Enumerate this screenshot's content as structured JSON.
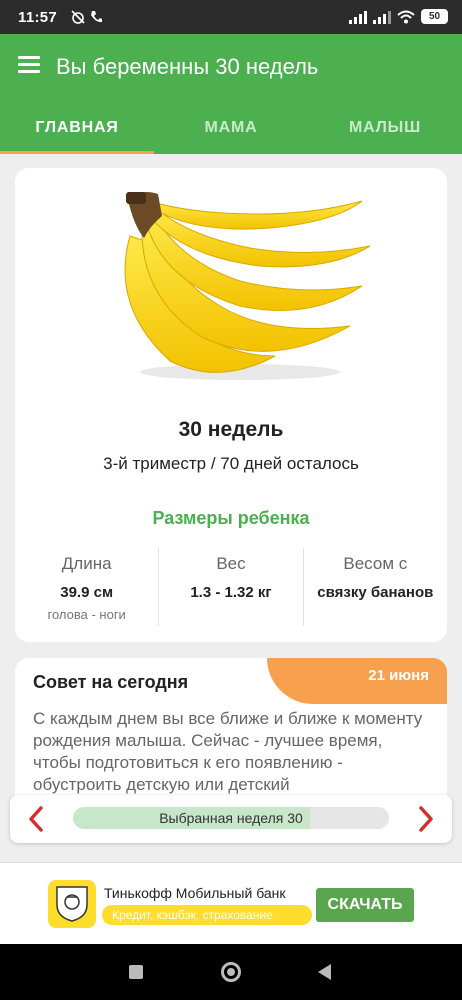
{
  "status_bar": {
    "time": "11:57",
    "battery": "50"
  },
  "app_bar": {
    "title": "Вы беременны 30 недель",
    "tabs": [
      {
        "label": "ГЛАВНАЯ",
        "selected": true
      },
      {
        "label": "МАМА",
        "selected": false
      },
      {
        "label": "МАЛЫШ",
        "selected": false
      }
    ]
  },
  "week_card": {
    "image": "banana-bunch",
    "week_title": "30 недель",
    "trimester_text": "3-й триместр / 70 дней осталось",
    "sizes_title": "Размеры ребенка",
    "stats": [
      {
        "label": "Длина",
        "value": "39.9 см",
        "sub": "голова - ноги"
      },
      {
        "label": "Вес",
        "value": "1.3 - 1.32 кг",
        "sub": ""
      },
      {
        "label": "Весом с",
        "value": "связку бананов",
        "sub": ""
      }
    ]
  },
  "tip_card": {
    "title": "Совет на сегодня",
    "date": "21 июня",
    "text": "С каждым днем вы все ближе и ближе к моменту рождения малыша. Сейчас - лучшее время, чтобы подготовиться к его появлению - обустроить детскую или детский"
  },
  "week_selector": {
    "label": "Выбранная неделя 30",
    "progress": 0.75
  },
  "ad": {
    "title": "Тинькофф Мобильный банк",
    "subtitle": "Кредит, кэшбэк, страхование",
    "button_label": "СКАЧАТЬ"
  },
  "colors": {
    "primary": "#4caf50",
    "accent": "#f7a14e",
    "arrow": "#d32f2f",
    "ad_yellow": "#ffdd2d",
    "ad_button": "#5aa64e"
  }
}
